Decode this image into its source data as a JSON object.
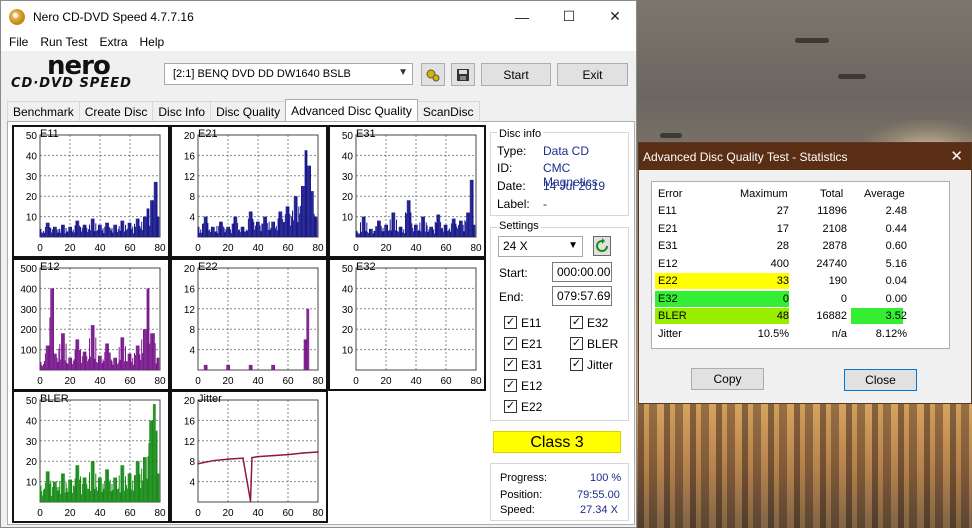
{
  "window": {
    "title": "Nero CD-DVD Speed 4.7.7.16",
    "controls": {
      "minimize": "—",
      "maximize": "☐",
      "close": "✕"
    }
  },
  "menu": [
    "File",
    "Run Test",
    "Extra",
    "Help"
  ],
  "logo": {
    "word": "nero",
    "subtitle": "CD·DVD SPEED"
  },
  "toolbar": {
    "drive": "[2:1]   BENQ DVD DD DW1640 BSLB",
    "start_label": "Start",
    "exit_label": "Exit"
  },
  "tabs": [
    "Benchmark",
    "Create Disc",
    "Disc Info",
    "Disc Quality",
    "Advanced Disc Quality",
    "ScanDisc"
  ],
  "active_tab": "Advanced Disc Quality",
  "disc_info": {
    "heading": "Disc info",
    "type_label": "Type:",
    "type": "Data CD",
    "id_label": "ID:",
    "id": "CMC Magnetics",
    "date_label": "Date:",
    "date": "14 Jul 2019",
    "label_label": "Label:",
    "label": "-"
  },
  "settings": {
    "heading": "Settings",
    "speed": "24 X",
    "start_label": "Start:",
    "start": "000:00.00",
    "end_label": "End:",
    "end": "079:57.69",
    "checks": [
      {
        "label": "E11",
        "checked": true
      },
      {
        "label": "E32",
        "checked": true
      },
      {
        "label": "E21",
        "checked": true
      },
      {
        "label": "BLER",
        "checked": true
      },
      {
        "label": "E31",
        "checked": true
      },
      {
        "label": "Jitter",
        "checked": true
      },
      {
        "label": "E12",
        "checked": true
      },
      {
        "label": "E22",
        "checked": true
      }
    ]
  },
  "class_result": "Class 3",
  "progress": {
    "progress_label": "Progress:",
    "progress": "100 %",
    "position_label": "Position:",
    "position": "79:55.00",
    "speed_label": "Speed:",
    "speed": "27.34 X"
  },
  "chart_data": [
    {
      "type": "bar",
      "title": "E11",
      "color": "#1a1a8c",
      "ylim": [
        0,
        50
      ],
      "yticks": [
        10,
        20,
        30,
        40,
        50
      ],
      "xticks": [
        0,
        20,
        40,
        60,
        80
      ],
      "x": [
        0,
        5,
        10,
        15,
        20,
        25,
        30,
        35,
        40,
        45,
        50,
        55,
        60,
        65,
        70,
        72,
        75,
        77,
        79
      ],
      "values": [
        4,
        7,
        5,
        6,
        5,
        8,
        6,
        9,
        6,
        7,
        6,
        8,
        7,
        9,
        10,
        14,
        18,
        27,
        10
      ]
    },
    {
      "type": "bar",
      "title": "E21",
      "color": "#1a1a8c",
      "ylim": [
        0,
        20
      ],
      "yticks": [
        4,
        8,
        12,
        16,
        20
      ],
      "xticks": [
        0,
        20,
        40,
        60,
        80
      ],
      "x": [
        0,
        5,
        10,
        15,
        20,
        25,
        30,
        35,
        40,
        45,
        50,
        55,
        60,
        65,
        70,
        72,
        74,
        76,
        79
      ],
      "values": [
        2,
        4,
        2,
        3,
        2,
        4,
        2,
        5,
        3,
        4,
        3,
        5,
        6,
        8,
        10,
        17,
        14,
        9,
        4
      ]
    },
    {
      "type": "bar",
      "title": "E31",
      "color": "#1a1a8c",
      "ylim": [
        0,
        50
      ],
      "yticks": [
        10,
        20,
        30,
        40,
        50
      ],
      "xticks": [
        0,
        20,
        40,
        60,
        80
      ],
      "x": [
        0,
        5,
        10,
        15,
        20,
        25,
        30,
        35,
        40,
        45,
        50,
        55,
        60,
        65,
        70,
        75,
        77,
        79
      ],
      "values": [
        3,
        10,
        4,
        8,
        6,
        12,
        5,
        18,
        6,
        10,
        5,
        11,
        6,
        9,
        8,
        12,
        28,
        6
      ]
    },
    {
      "type": "bar",
      "title": "E12",
      "color": "#7a1a8c",
      "ylim": [
        0,
        500
      ],
      "yticks": [
        100,
        200,
        300,
        400,
        500
      ],
      "xticks": [
        0,
        20,
        40,
        60,
        80
      ],
      "x": [
        0,
        5,
        8,
        10,
        15,
        20,
        25,
        30,
        35,
        40,
        45,
        50,
        55,
        60,
        65,
        70,
        72,
        75,
        79
      ],
      "values": [
        40,
        120,
        400,
        80,
        180,
        60,
        150,
        90,
        220,
        70,
        130,
        60,
        160,
        80,
        120,
        200,
        400,
        180,
        60
      ]
    },
    {
      "type": "bar",
      "title": "E22",
      "color": "#7a1a8c",
      "ylim": [
        0,
        20
      ],
      "yticks": [
        4,
        8,
        12,
        16,
        20
      ],
      "xticks": [
        0,
        20,
        40,
        60,
        80
      ],
      "x": [
        5,
        20,
        35,
        50,
        72,
        73
      ],
      "values": [
        1,
        1,
        1,
        1,
        6,
        12
      ]
    },
    {
      "type": "bar",
      "title": "E32",
      "color": "#7a1a8c",
      "ylim": [
        0,
        50
      ],
      "yticks": [
        10,
        20,
        30,
        40,
        50
      ],
      "xticks": [
        0,
        20,
        40,
        60,
        80
      ],
      "x": [],
      "values": []
    },
    {
      "type": "bar",
      "title": "BLER",
      "color": "#1a8c1a",
      "ylim": [
        0,
        50
      ],
      "yticks": [
        10,
        20,
        30,
        40,
        50
      ],
      "xticks": [
        0,
        20,
        40,
        60,
        80
      ],
      "x": [
        0,
        5,
        10,
        15,
        20,
        25,
        30,
        35,
        40,
        45,
        50,
        55,
        60,
        65,
        70,
        74,
        76,
        78,
        79
      ],
      "values": [
        8,
        15,
        10,
        14,
        11,
        18,
        12,
        20,
        12,
        16,
        12,
        18,
        14,
        20,
        22,
        40,
        48,
        35,
        14
      ]
    },
    {
      "type": "line",
      "title": "Jitter",
      "color": "#8c1a3a",
      "ylim": [
        0,
        20
      ],
      "yticks": [
        4,
        8,
        12,
        16,
        20
      ],
      "xticks": [
        0,
        20,
        40,
        60,
        80
      ],
      "x": [
        0,
        10,
        20,
        30,
        35,
        36,
        40,
        50,
        60,
        70,
        80
      ],
      "values": [
        7.5,
        8.1,
        8.4,
        8.6,
        0.2,
        8.7,
        8.9,
        9.1,
        9.3,
        9.6,
        9.8
      ]
    }
  ],
  "stats_dialog": {
    "title": "Advanced Disc Quality Test - Statistics",
    "close": "✕",
    "headers": [
      "Error",
      "Maximum",
      "Total",
      "Average"
    ],
    "rows": [
      {
        "error": "E11",
        "max": "27",
        "total": "11896",
        "avg": "2.48",
        "hl": ""
      },
      {
        "error": "E21",
        "max": "17",
        "total": "2108",
        "avg": "0.44",
        "hl": ""
      },
      {
        "error": "E31",
        "max": "28",
        "total": "2878",
        "avg": "0.60",
        "hl": ""
      },
      {
        "error": "E12",
        "max": "400",
        "total": "24740",
        "avg": "5.16",
        "hl": ""
      },
      {
        "error": "E22",
        "max": "33",
        "total": "190",
        "avg": "0.04",
        "hl": "#ffff00"
      },
      {
        "error": "E32",
        "max": "0",
        "total": "0",
        "avg": "0.00",
        "hl": "#33ee33"
      },
      {
        "error": "BLER",
        "max": "48",
        "total": "16882",
        "avg": "3.52",
        "hl": "#99ee00"
      },
      {
        "error": "Jitter",
        "max": "10.5%",
        "total": "n/a",
        "avg": "8.12%",
        "hl": ""
      }
    ],
    "copy_label": "Copy",
    "close_label": "Close"
  }
}
